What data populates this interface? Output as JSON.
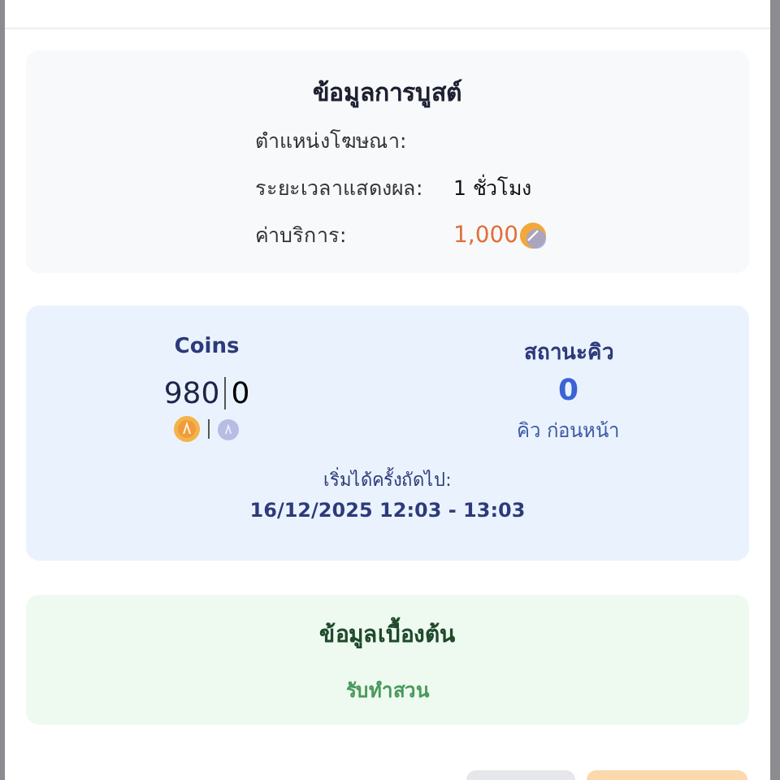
{
  "boost_info": {
    "title": "ข้อมูลการบูสต์",
    "rows": [
      {
        "label": "ตำแหน่งโฆษณา:",
        "kind": "text"
      },
      {
        "label": "ระยะเวลาแสดงผล:",
        "value": "1 ชั่วโมง",
        "kind": "text"
      },
      {
        "label": "ค่าบริการ:",
        "value": "1,000",
        "kind": "price"
      }
    ]
  },
  "coins": {
    "title": "Coins",
    "primary": "980",
    "secondary": "0"
  },
  "queue": {
    "title": "สถานะคิว",
    "count": "0",
    "caption": "คิว ก่อนหน้า"
  },
  "next_start": {
    "label": "เริ่มได้ครั้งถัดไป:",
    "time": "16/12/2025 12:03 - 13:03"
  },
  "basic_info": {
    "title": "ข้อมูลเบื้องต้น",
    "value": "รับทำสวน"
  },
  "buttons": [
    {
      "kind": "secondary"
    },
    {
      "kind": "primary"
    }
  ]
}
